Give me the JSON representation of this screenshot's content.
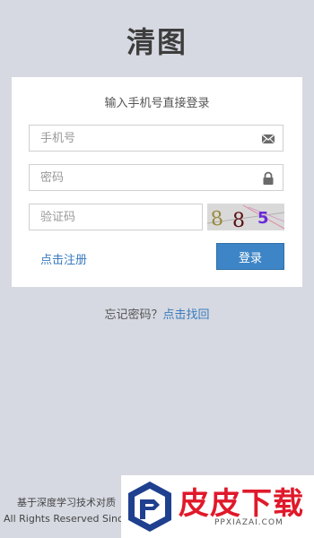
{
  "app": {
    "title": "清图"
  },
  "login": {
    "subtitle": "输入手机号直接登录",
    "phone_placeholder": "手机号",
    "password_placeholder": "密码",
    "captcha_placeholder": "验证码",
    "captcha_text": "885",
    "register_label": "点击注册",
    "login_label": "登录"
  },
  "forgot": {
    "prompt": "忘记密码？",
    "link": "点击找回"
  },
  "footer": {
    "line1": "基于深度学习技术对质",
    "line2": "All Rights Reserved Since"
  },
  "watermark": {
    "brand": "皮皮下载",
    "domain": "PPXIAZAI.COM"
  },
  "colors": {
    "background": "#d6d9e1",
    "accent": "#3d85c6",
    "link": "#3a7bbf",
    "watermark_red": "#e0192b"
  },
  "icons": {
    "phone_field": "envelope-icon",
    "password_field": "lock-icon"
  }
}
